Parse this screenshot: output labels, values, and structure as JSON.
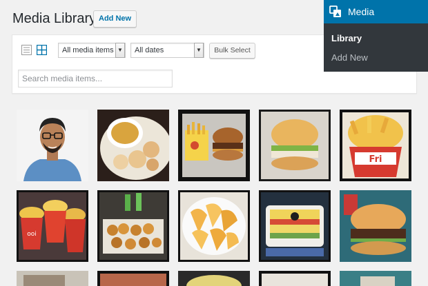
{
  "header": {
    "title": "Media Library",
    "add_new_label": "Add New"
  },
  "toolbar": {
    "view_modes": [
      "list-view-icon",
      "grid-view-icon"
    ],
    "active_view": "grid",
    "type_filter": "All media items",
    "date_filter": "All dates",
    "bulk_select_label": "Bulk Select",
    "search_placeholder": "Search media items..."
  },
  "media_menu": {
    "title": "Media",
    "icon": "media-icon",
    "items": [
      "Library",
      "Add New"
    ],
    "active": "Library",
    "header_color": "#0073aa",
    "background_color": "#32373c"
  },
  "grid": {
    "items": [
      "person-portrait-thumbnail",
      "tea-and-dumplings-thumbnail",
      "burger-and-fries-tray-thumbnail",
      "burger-closeup-thumbnail",
      "fries-bucket-thumbnail",
      "fries-cups-thumbnail",
      "pastries-platter-thumbnail",
      "potato-wedges-thumbnail",
      "layered-dish-thumbnail",
      "burger-thumbnail-2",
      "partial-thumbnail-1",
      "partial-thumbnail-2",
      "partial-thumbnail-3",
      "partial-thumbnail-4",
      "partial-thumbnail-5"
    ]
  }
}
